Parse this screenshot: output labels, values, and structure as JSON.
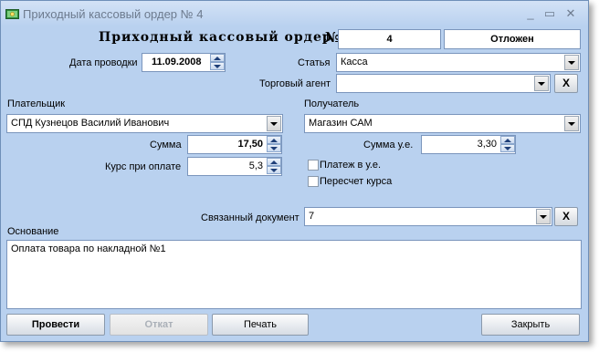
{
  "window": {
    "title": "Приходный кассовый ордер № 4",
    "controls": {
      "minimize": "_",
      "maximize": "▭",
      "close": "✕"
    }
  },
  "header": {
    "title": "Приходный кассовый ордер",
    "number_sign": "№",
    "number": "4",
    "status": "Отложен"
  },
  "posting_date": {
    "label": "Дата проводки",
    "value": "11.09.2008"
  },
  "article": {
    "label": "Статья",
    "value": "Касса"
  },
  "trade_agent": {
    "label": "Торговый агент",
    "value": "",
    "clear_label": "X"
  },
  "payer": {
    "label": "Плательщик",
    "value": "СПД Кузнецов Василий Иванович"
  },
  "recipient": {
    "label": "Получатель",
    "value": "Магазин САМ"
  },
  "amount": {
    "label": "Сумма",
    "value": "17,50"
  },
  "amount_ue": {
    "label": "Сумма у.е.",
    "value": "3,30"
  },
  "rate": {
    "label": "Курс при оплате",
    "value": "5,3"
  },
  "checkboxes": [
    {
      "label": "Платеж в у.е.",
      "checked": false
    },
    {
      "label": "Пересчет курса",
      "checked": false
    }
  ],
  "related_doc": {
    "label": "Связанный документ",
    "value": "7",
    "clear_label": "X"
  },
  "basis": {
    "label": "Основание",
    "value": "Оплата товара по накладной №1"
  },
  "buttons": {
    "post": "Провести",
    "rollback": "Откат",
    "print": "Печать",
    "close": "Закрыть"
  },
  "colors": {
    "window_bg": "#b9d1ef",
    "title_text": "#6d7b8e"
  }
}
